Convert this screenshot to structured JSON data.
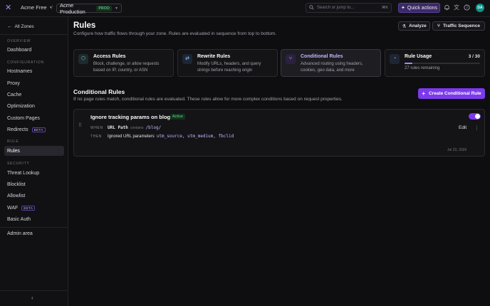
{
  "topbar": {
    "account": "Acme Free",
    "zone": "Acme Production",
    "zone_badge": "PROD",
    "search_placeholder": "Search or jump to...",
    "search_shortcut": "⌘K",
    "quick_actions": "Quick actions",
    "avatar_initials": "DA"
  },
  "sidebar": {
    "back_label": "All Zones",
    "sections": {
      "overview": "OVERVIEW",
      "configuration": "CONFIGURATION",
      "rule": "RULE",
      "security": "SECURITY"
    },
    "items": {
      "dashboard": "Dashboard",
      "hostnames": "Hostnames",
      "proxy": "Proxy",
      "cache": "Cache",
      "optimization": "Optimization",
      "custom_pages": "Custom Pages",
      "redirects": "Redirects",
      "rules": "Rules",
      "threat_lookup": "Threat Lookup",
      "blocklist": "Blocklist",
      "allowlist": "Allowlist",
      "waf": "WAF",
      "basic_auth": "Basic Auth",
      "admin_area": "Admin area"
    },
    "beta_label": "BETA"
  },
  "header": {
    "title": "Rules",
    "subtitle": "Configure how traffic flows through your zone. Rules are evaluated in sequence from top to bottom.",
    "analyze": "Analyze",
    "traffic_sequence": "Traffic Sequence"
  },
  "cards": [
    {
      "title": "Access Rules",
      "desc": "Block, challenge, or allow requests based on IP, country, or ASN"
    },
    {
      "title": "Rewrite Rules",
      "desc": "Modify URLs, headers, and query strings before reaching origin"
    },
    {
      "title": "Conditional Rules",
      "desc": "Advanced routing using headers, cookies, geo data, and more"
    }
  ],
  "usage": {
    "title": "Rule Usage",
    "count": "3 / 30",
    "fraction": 0.1,
    "remaining": "27 rules remaining"
  },
  "conditional": {
    "title": "Conditional Rules",
    "subtitle": "If no page rules match, conditional rules are evaluated. These rules allow for more complex conditions based on request properties.",
    "create": "Create Conditional Rule"
  },
  "rule": {
    "name": "Ignore tracking params on blog",
    "status": "Active",
    "when_label": "WHEN",
    "then_label": "THEN",
    "when_field": "URL Path",
    "when_op": "contains",
    "when_value": "/blog/",
    "then_action": "Ignored URL parameters",
    "then_value": "utm_source, utm_medium, fbclid",
    "edit": "Edit",
    "date": "Jul 23, 2026",
    "enabled": true
  },
  "colors": {
    "accent": "#7c3aed",
    "accent_light": "#a78bfa",
    "success": "#4ade80"
  }
}
